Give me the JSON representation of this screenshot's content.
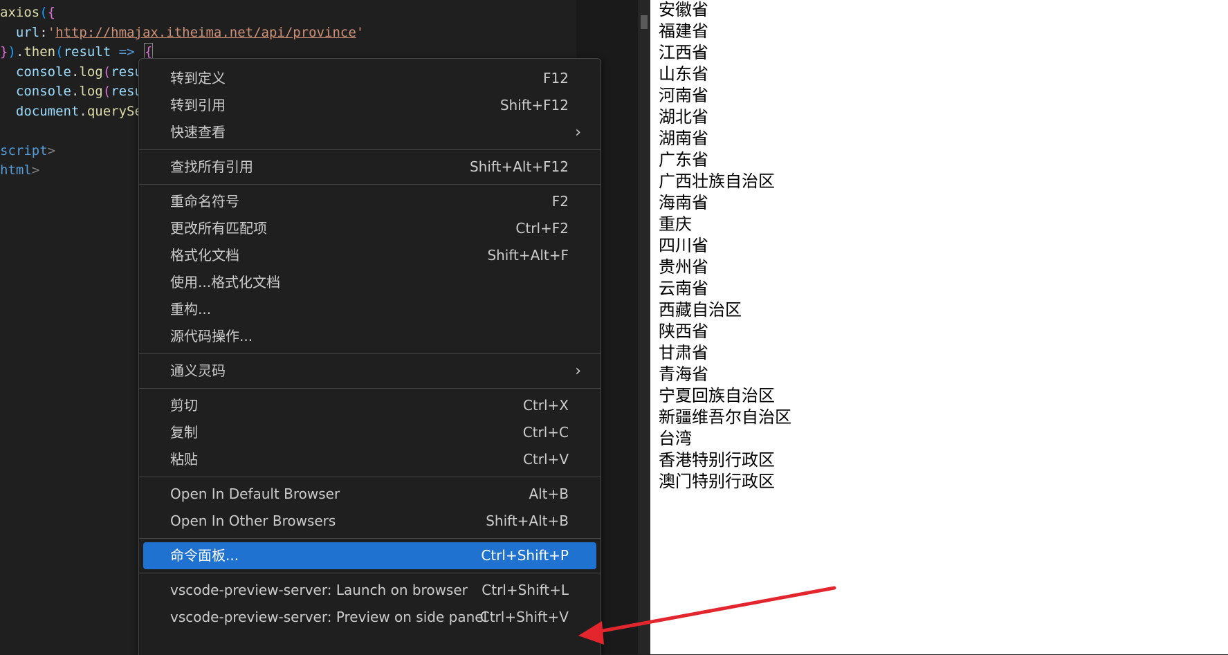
{
  "editor": {
    "lines": [
      {
        "segments": [
          {
            "t": "axios",
            "c": "fn"
          },
          {
            "t": "(",
            "c": "brace2"
          },
          {
            "t": "{",
            "c": "brace"
          }
        ]
      },
      {
        "segments": [
          {
            "t": "  url",
            "c": "prop"
          },
          {
            "t": ":",
            "c": "punc"
          },
          {
            "t": "'",
            "c": "str0"
          },
          {
            "t": "http://hmajax.itheima.net/api/province",
            "c": "str"
          },
          {
            "t": "'",
            "c": "str0"
          }
        ]
      },
      {
        "segments": [
          {
            "t": "}",
            "c": "brace"
          },
          {
            "t": ")",
            "c": "brace2"
          },
          {
            "t": ".",
            "c": "punc"
          },
          {
            "t": "then",
            "c": "fn"
          },
          {
            "t": "(",
            "c": "brace2"
          },
          {
            "t": "result",
            "c": "param"
          },
          {
            "t": " => ",
            "c": "kw"
          },
          {
            "t": "{",
            "c": "cursorbrace"
          }
        ]
      },
      {
        "segments": [
          {
            "t": "  console",
            "c": "prop"
          },
          {
            "t": ".",
            "c": "punc"
          },
          {
            "t": "log",
            "c": "fn"
          },
          {
            "t": "(",
            "c": "brace"
          },
          {
            "t": "resu",
            "c": "param"
          }
        ]
      },
      {
        "segments": [
          {
            "t": "  console",
            "c": "prop"
          },
          {
            "t": ".",
            "c": "punc"
          },
          {
            "t": "log",
            "c": "fn"
          },
          {
            "t": "(",
            "c": "brace"
          },
          {
            "t": "resu",
            "c": "param"
          }
        ]
      },
      {
        "segments": [
          {
            "t": "  document",
            "c": "prop"
          },
          {
            "t": ".",
            "c": "punc"
          },
          {
            "t": "querySe",
            "c": "fn"
          }
        ]
      },
      {
        "segments": []
      },
      {
        "segments": [
          {
            "t": "script",
            "c": "tag"
          },
          {
            "t": ">",
            "c": "ang"
          }
        ]
      },
      {
        "segments": [
          {
            "t": "html",
            "c": "tag"
          },
          {
            "t": ">",
            "c": "ang"
          }
        ]
      }
    ]
  },
  "preview": {
    "provinces": [
      "安徽省",
      "福建省",
      "江西省",
      "山东省",
      "河南省",
      "湖北省",
      "湖南省",
      "广东省",
      "广西壮族自治区",
      "海南省",
      "重庆",
      "四川省",
      "贵州省",
      "云南省",
      "西藏自治区",
      "陕西省",
      "甘肃省",
      "青海省",
      "宁夏回族自治区",
      "新疆维吾尔自治区",
      "台湾",
      "香港特别行政区",
      "澳门特别行政区"
    ]
  },
  "context_menu": {
    "items": [
      {
        "label": "转到定义",
        "key": "F12"
      },
      {
        "label": "转到引用",
        "key": "Shift+F12"
      },
      {
        "label": "快速查看",
        "key": "",
        "submenu": true
      },
      {
        "separator": true
      },
      {
        "label": "查找所有引用",
        "key": "Shift+Alt+F12"
      },
      {
        "separator": true
      },
      {
        "label": "重命名符号",
        "key": "F2"
      },
      {
        "label": "更改所有匹配项",
        "key": "Ctrl+F2"
      },
      {
        "label": "格式化文档",
        "key": "Shift+Alt+F"
      },
      {
        "label": "使用...格式化文档",
        "key": ""
      },
      {
        "label": "重构...",
        "key": ""
      },
      {
        "label": "源代码操作...",
        "key": ""
      },
      {
        "separator": true
      },
      {
        "label": "通义灵码",
        "key": "",
        "submenu": true
      },
      {
        "separator": true
      },
      {
        "label": "剪切",
        "key": "Ctrl+X"
      },
      {
        "label": "复制",
        "key": "Ctrl+C"
      },
      {
        "label": "粘贴",
        "key": "Ctrl+V"
      },
      {
        "separator": true
      },
      {
        "label": "Open In Default Browser",
        "key": "Alt+B"
      },
      {
        "label": "Open In Other Browsers",
        "key": "Shift+Alt+B"
      },
      {
        "separator": true
      },
      {
        "label": "命令面板...",
        "key": "Ctrl+Shift+P",
        "active": true
      },
      {
        "separator": true
      },
      {
        "label": "vscode-preview-server: Launch on browser",
        "key": "Ctrl+Shift+L"
      },
      {
        "label": "vscode-preview-server: Preview on side panel",
        "key": "Ctrl+Shift+V"
      }
    ],
    "chevron_icon": "chevron-right-icon"
  },
  "annotation": {
    "color": "#e3262e",
    "icon": "red-arrow-icon"
  }
}
